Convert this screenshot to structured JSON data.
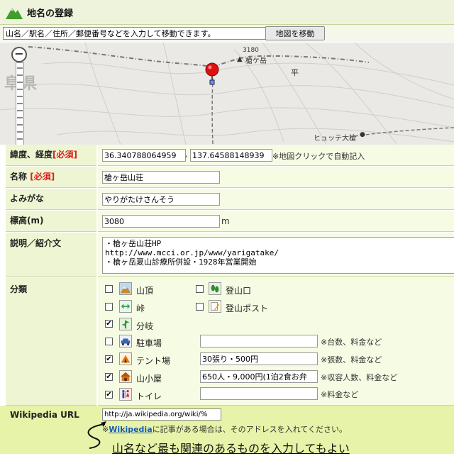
{
  "header": {
    "title": "地名の登録"
  },
  "search": {
    "value": "山名／駅名／住所／郵便番号などを入力して移動できます。",
    "button_label": "地図を移動"
  },
  "map": {
    "prefecture_label": "阜県",
    "peak_elevation": "3180",
    "peak_name": "槍ケ岳",
    "area_label": "平",
    "hut_label": "ヒュッテ大槍"
  },
  "form": {
    "coords": {
      "label": "緯度、経度",
      "required": "[必須]",
      "lat": "36.340788064959",
      "sep": ",",
      "lng": "137.64588148939",
      "note": "※地図クリックで自動記入"
    },
    "name": {
      "label": "名称",
      "required": "[必須]",
      "value": "槍ヶ岳山荘"
    },
    "reading": {
      "label": "よみがな",
      "value": "やりがたけさんそう"
    },
    "elevation": {
      "label": "標高(m)",
      "value": "3080",
      "unit": "m"
    },
    "description": {
      "label": "説明／紹介文",
      "value": "・槍ヶ岳山荘HP\nhttp://www.mcci.or.jp/www/yarigatake/\n・槍ヶ岳夏山診療所併設・1928年営業開始"
    },
    "category": {
      "label": "分類",
      "items": [
        {
          "label": "山頂",
          "checked": false,
          "icon": "mountain-icon"
        },
        {
          "label": "登山口",
          "checked": false,
          "icon": "footprints-icon"
        },
        {
          "label": "峠",
          "checked": false,
          "icon": "pass-arrows-icon"
        },
        {
          "label": "登山ポスト",
          "checked": false,
          "icon": "post-pencil-icon"
        },
        {
          "label": "分岐",
          "checked": true,
          "icon": "junction-sign-icon"
        },
        {
          "label": "駐車場",
          "checked": false,
          "icon": "car-icon",
          "value": "",
          "note": "※台数、料金など"
        },
        {
          "label": "テント場",
          "checked": true,
          "icon": "tent-icon",
          "value": "30張り・500円",
          "note": "※張数、料金など"
        },
        {
          "label": "山小屋",
          "checked": true,
          "icon": "hut-icon",
          "value": "650人・9,000円(1泊2食お弁",
          "note": "※収容人数、料金など"
        },
        {
          "label": "トイレ",
          "checked": true,
          "icon": "toilet-icon",
          "value": "",
          "note": "※料金など"
        }
      ]
    },
    "wikipedia": {
      "label": "Wikipedia URL",
      "value": "http://ja.wikipedia.org/wiki/%",
      "note_prefix": "※",
      "note_link": "Wikipedia",
      "note_suffix": "に記事がある場合は、そのアドレスを入れてください。"
    }
  },
  "hint": "山名など最も関連のあるものを入力してもよい",
  "colors": {
    "required": "#d22222",
    "label_bg": "#eef5d2",
    "value_bg": "#f6fbe3",
    "wiki_band": "#e6f3a8",
    "link": "#1a5ab0"
  }
}
